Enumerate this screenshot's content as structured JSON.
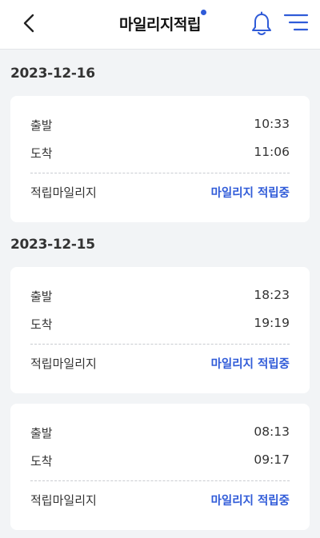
{
  "header": {
    "title": "마일리지적립",
    "back_icon": "chevron-left-icon",
    "bell_icon": "bell-icon",
    "menu_icon": "menu-icon",
    "accent_color": "#2f5bd8"
  },
  "groups": [
    {
      "date": "2023-12-16",
      "records": [
        {
          "departure_label": "출발",
          "departure_time": "10:33",
          "arrival_label": "도착",
          "arrival_time": "11:06",
          "mileage_label": "적립마일리지",
          "mileage_status": "마일리지 적립중"
        }
      ]
    },
    {
      "date": "2023-12-15",
      "records": [
        {
          "departure_label": "출발",
          "departure_time": "18:23",
          "arrival_label": "도착",
          "arrival_time": "19:19",
          "mileage_label": "적립마일리지",
          "mileage_status": "마일리지 적립중"
        },
        {
          "departure_label": "출발",
          "departure_time": "08:13",
          "arrival_label": "도착",
          "arrival_time": "09:17",
          "mileage_label": "적립마일리지",
          "mileage_status": "마일리지 적립중"
        }
      ]
    }
  ]
}
